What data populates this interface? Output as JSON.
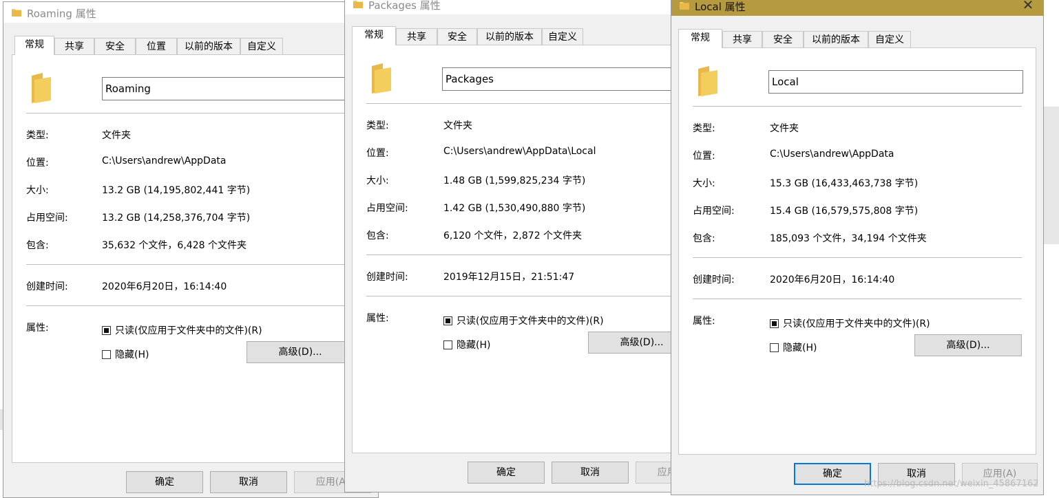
{
  "dialogs": {
    "roaming": {
      "title": "Roaming 属性",
      "tabs": [
        "常规",
        "共享",
        "安全",
        "位置",
        "以前的版本",
        "自定义"
      ],
      "name_value": "Roaming",
      "labels": {
        "type": "类型:",
        "location": "位置:",
        "size": "大小:",
        "size_on_disk": "占用空间:",
        "contains": "包含:",
        "created": "创建时间:",
        "attributes": "属性:"
      },
      "values": {
        "type": "文件夹",
        "location": "C:\\Users\\andrew\\AppData",
        "size": "13.2 GB (14,195,802,441 字节)",
        "size_on_disk": "13.2 GB (14,258,376,704 字节)",
        "contains": "35,632 个文件，6,428 个文件夹",
        "created": "2020年6月20日，16:14:40"
      },
      "readonly_label": "只读(仅应用于文件夹中的文件)(R)",
      "hidden_label": "隐藏(H)",
      "advanced_label": "高级(D)...",
      "ok_label": "确定",
      "cancel_label": "取消",
      "apply_label": "应用(A)"
    },
    "packages": {
      "title": "Packages 属性",
      "tabs": [
        "常规",
        "共享",
        "安全",
        "以前的版本",
        "自定义"
      ],
      "name_value": "Packages",
      "labels": {
        "type": "类型:",
        "location": "位置:",
        "size": "大小:",
        "size_on_disk": "占用空间:",
        "contains": "包含:",
        "created": "创建时间:",
        "attributes": "属性:"
      },
      "values": {
        "type": "文件夹",
        "location": "C:\\Users\\andrew\\AppData\\Local",
        "size": "1.48 GB (1,599,825,234 字节)",
        "size_on_disk": "1.42 GB (1,530,490,880 字节)",
        "contains": "6,120 个文件，2,872 个文件夹",
        "created": "2019年12月15日，21:51:47"
      },
      "readonly_label": "只读(仅应用于文件夹中的文件)(R)",
      "hidden_label": "隐藏(H)",
      "advanced_label": "高级(D)...",
      "ok_label": "确定",
      "cancel_label": "取消",
      "apply_label": "应用(A)"
    },
    "local": {
      "title": "Local 属性",
      "tabs": [
        "常规",
        "共享",
        "安全",
        "以前的版本",
        "自定义"
      ],
      "name_value": "Local",
      "labels": {
        "type": "类型:",
        "location": "位置:",
        "size": "大小:",
        "size_on_disk": "占用空间:",
        "contains": "包含:",
        "created": "创建时间:",
        "attributes": "属性:"
      },
      "values": {
        "type": "文件夹",
        "location": "C:\\Users\\andrew\\AppData",
        "size": "15.3 GB (16,433,463,738 字节)",
        "size_on_disk": "15.4 GB (16,579,575,808 字节)",
        "contains": "185,093 个文件，34,194 个文件夹",
        "created": "2020年6月20日，16:14:40"
      },
      "readonly_label": "只读(仅应用于文件夹中的文件)(R)",
      "hidden_label": "隐藏(H)",
      "advanced_label": "高级(D)...",
      "ok_label": "确定",
      "cancel_label": "取消",
      "apply_label": "应用(A)",
      "close_glyph": "✕"
    }
  },
  "watermark": "https://blog.csdn.net/weixin_45867162",
  "colors": {
    "active_titlebar": "#b59a40",
    "default_button_border": "#0078d7",
    "folder_yellow": "#f4ce5c"
  }
}
